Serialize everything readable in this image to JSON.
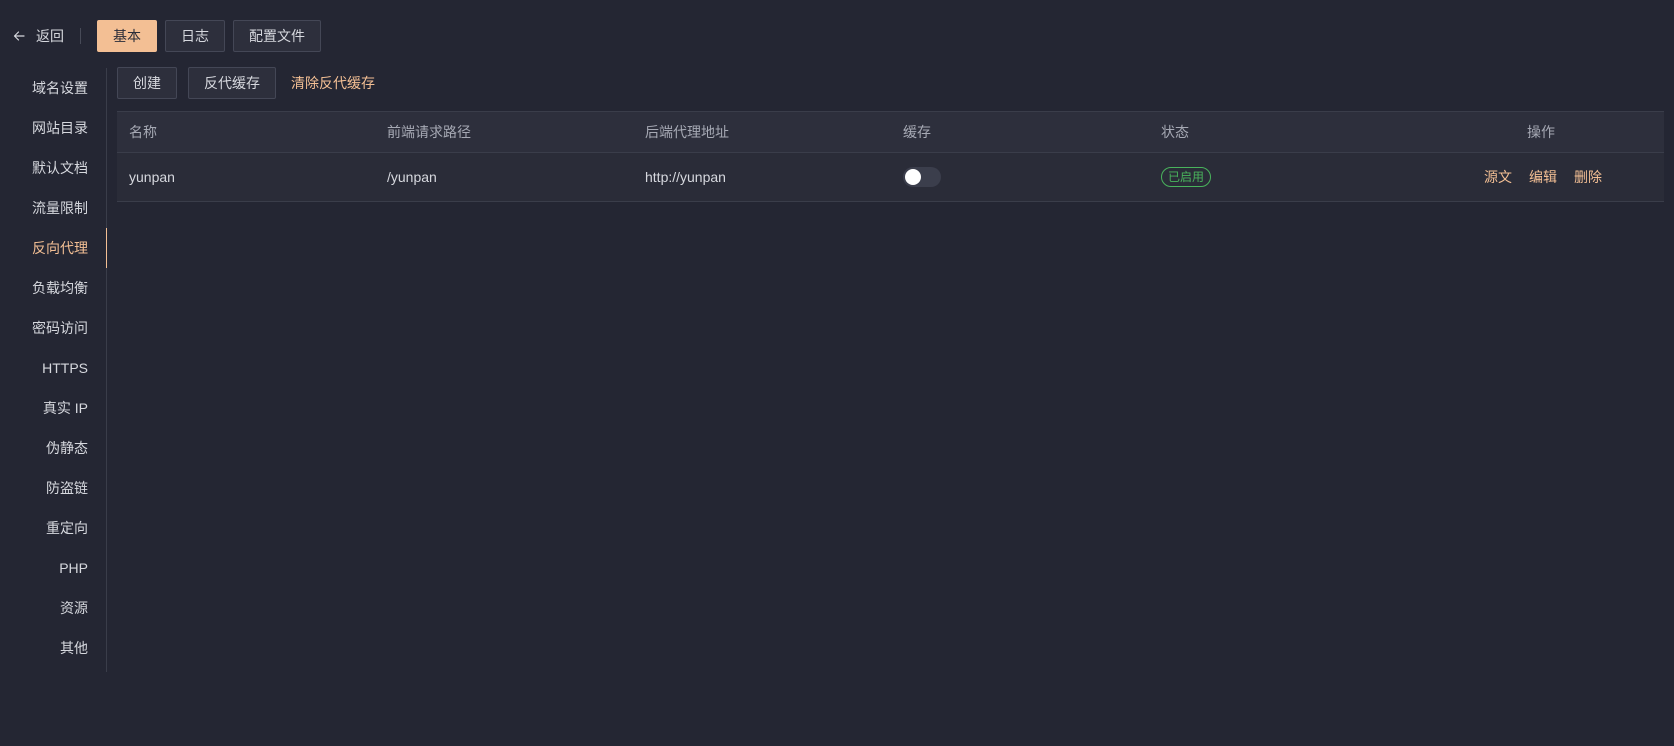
{
  "topbar": {
    "back_label": "返回",
    "tabs": [
      {
        "label": "基本",
        "active": true
      },
      {
        "label": "日志",
        "active": false
      },
      {
        "label": "配置文件",
        "active": false
      }
    ]
  },
  "sidebar": {
    "items": [
      {
        "label": "域名设置"
      },
      {
        "label": "网站目录"
      },
      {
        "label": "默认文档"
      },
      {
        "label": "流量限制"
      },
      {
        "label": "反向代理",
        "active": true
      },
      {
        "label": "负载均衡"
      },
      {
        "label": "密码访问"
      },
      {
        "label": "HTTPS"
      },
      {
        "label": "真实 IP"
      },
      {
        "label": "伪静态"
      },
      {
        "label": "防盗链"
      },
      {
        "label": "重定向"
      },
      {
        "label": "PHP"
      },
      {
        "label": "资源"
      },
      {
        "label": "其他"
      }
    ]
  },
  "toolbar": {
    "create_label": "创建",
    "proxy_cache_label": "反代缓存",
    "clear_cache_label": "清除反代缓存"
  },
  "table": {
    "headers": {
      "name": "名称",
      "path": "前端请求路径",
      "address": "后端代理地址",
      "cache": "缓存",
      "status": "状态",
      "ops": "操作"
    },
    "rows": [
      {
        "name": "yunpan",
        "path": "/yunpan",
        "address": "http://yunpan",
        "cache_enabled": false,
        "status": "已启用",
        "ops": {
          "source": "源文",
          "edit": "编辑",
          "delete": "删除"
        }
      }
    ]
  },
  "colors": {
    "background": "#242633",
    "accent": "#f3bf94",
    "status_green": "#49b35c"
  },
  "icons": {
    "back": "arrow-left-icon"
  }
}
